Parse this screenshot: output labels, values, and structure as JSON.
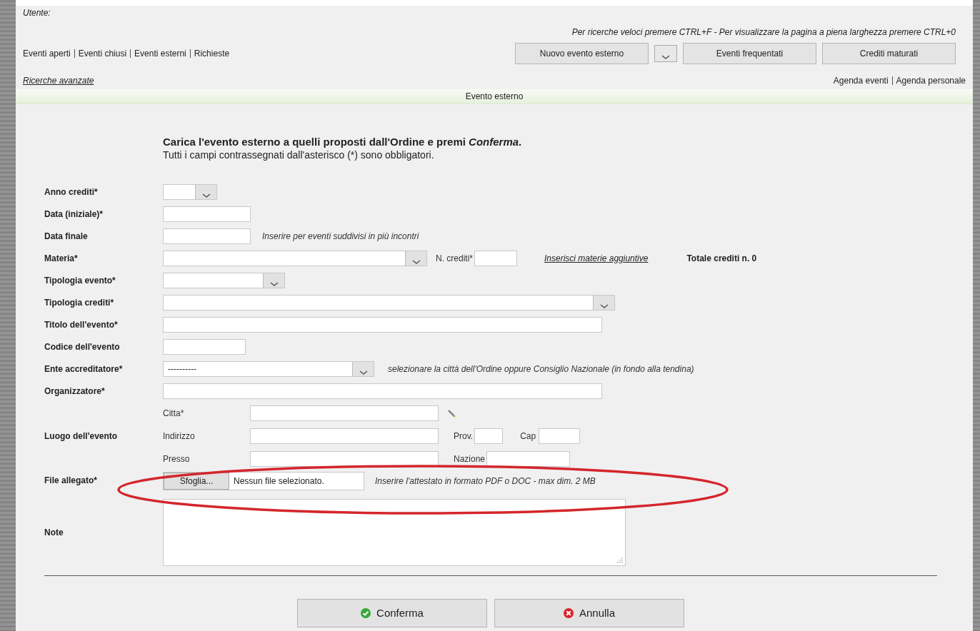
{
  "header": {
    "user_label": "Utente:",
    "hint": "Per ricerche veloci premere CTRL+F - Per visualizzare la pagina a piena larghezza premere CTRL+0",
    "nav_links": [
      "Eventi aperti",
      "Eventi chiusi",
      "Eventi esterni",
      "Richieste"
    ],
    "buttons": [
      {
        "kind": "button",
        "label": "Nuovo evento esterno"
      },
      {
        "kind": "dropdown"
      },
      {
        "kind": "button",
        "label": "Eventi frequentati"
      },
      {
        "kind": "button",
        "label": "Crediti maturati"
      }
    ],
    "advanced_search": "Ricerche avanzate",
    "agenda_links": [
      "Agenda eventi",
      "Agenda personale"
    ]
  },
  "section_title": "Evento esterno",
  "intro": {
    "heading": "Carica l'evento esterno a quelli proposti dall'Ordine e premi *Conferma*.",
    "note": "Tutti i campi contrassegnati dall'asterisco (*) sono obbligatori."
  },
  "form": {
    "rows": [
      {
        "label": "Anno crediti*",
        "controls": [
          {
            "kind": "select"
          }
        ]
      },
      {
        "label": "Data (iniziale)*",
        "controls": [
          {
            "kind": "input"
          }
        ]
      },
      {
        "label": "Data finale",
        "controls": [
          {
            "kind": "input"
          },
          {
            "kind": "hint",
            "text": "Inserire per eventi suddivisi in più incontri"
          }
        ]
      },
      {
        "label": "Materia*",
        "controls": [
          {
            "kind": "select"
          },
          {
            "kind": "label",
            "text": "N. crediti*"
          },
          {
            "kind": "input"
          },
          {
            "kind": "link",
            "text": "Inserisci materie aggiuntive"
          },
          {
            "kind": "total",
            "text": "Totale crediti n. 0"
          }
        ]
      },
      {
        "label": "Tipologia evento*",
        "controls": [
          {
            "kind": "select"
          }
        ]
      },
      {
        "label": "Tipologia crediti*",
        "controls": [
          {
            "kind": "select"
          }
        ]
      },
      {
        "label": "Titolo dell'evento*",
        "controls": [
          {
            "kind": "input"
          }
        ]
      },
      {
        "label": "Codice dell'evento",
        "controls": [
          {
            "kind": "input"
          }
        ]
      },
      {
        "label": "Ente accreditatore*",
        "controls": [
          {
            "kind": "select",
            "value": "----------"
          },
          {
            "kind": "hint",
            "text": "selezionare la città dell'Ordine oppure Consiglio Nazionale (in fondo alla tendina)"
          }
        ]
      },
      {
        "label": "Organizzatore*",
        "controls": [
          {
            "kind": "input"
          }
        ]
      },
      {
        "label": "Luogo dell'evento",
        "children": [
          {
            "label": "Citta*",
            "controls": [
              {
                "kind": "input"
              },
              {
                "kind": "pencil"
              }
            ]
          },
          {
            "label": "Indirizzo",
            "controls": [
              {
                "kind": "input"
              },
              {
                "kind": "label",
                "text": "Prov."
              },
              {
                "kind": "input"
              },
              {
                "kind": "label",
                "text": "Cap"
              },
              {
                "kind": "input"
              }
            ]
          },
          {
            "label": "Presso",
            "controls": [
              {
                "kind": "input"
              },
              {
                "kind": "label",
                "text": "Nazione"
              },
              {
                "kind": "input"
              }
            ]
          }
        ]
      },
      {
        "label": "File allegato*",
        "controls": [
          {
            "kind": "file",
            "button": "Sfoglia...",
            "status": "Nessun file selezionato."
          },
          {
            "kind": "hint",
            "text": "Inserire l'attestato in formato PDF o DOC - max dim. 2 MB"
          }
        ]
      },
      {
        "label": "Note",
        "controls": [
          {
            "kind": "textarea"
          }
        ]
      }
    ]
  },
  "actions": [
    {
      "kind": "confirm",
      "label": "Conferma"
    },
    {
      "kind": "cancel",
      "label": "Annulla"
    }
  ]
}
